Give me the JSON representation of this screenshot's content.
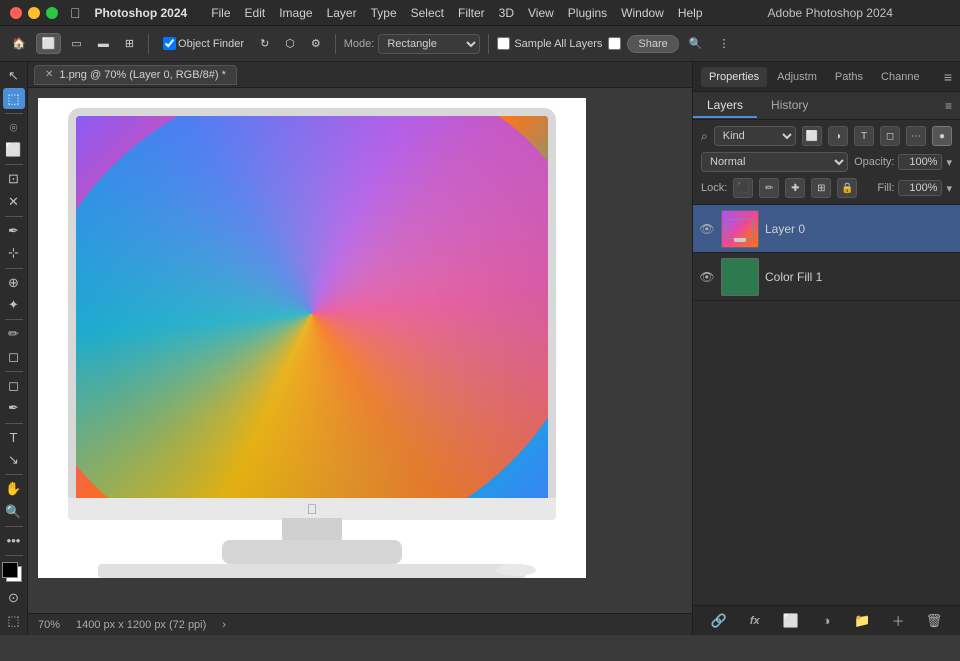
{
  "titlebar": {
    "app_name": "Photoshop 2024",
    "menu_items": [
      "File",
      "Edit",
      "Image",
      "Layer",
      "Type",
      "Select",
      "Filter",
      "3D",
      "View",
      "Plugins",
      "Window",
      "Help"
    ],
    "center_title": "Adobe Photoshop 2024"
  },
  "toolbar": {
    "object_finder": "Object Finder",
    "mode_label": "Mode:",
    "mode_value": "Rectangle",
    "sample_all_layers": "Sample All Layers",
    "share_label": "Share"
  },
  "tab": {
    "filename": "1.png @ 70% (Layer 0, RGB/8#) *"
  },
  "panels": {
    "properties_label": "Properties",
    "adjustments_label": "Adjustm",
    "paths_label": "Paths",
    "channels_label": "Channe",
    "layers_label": "Layers",
    "history_label": "History"
  },
  "layers": {
    "kind_label": "Kind",
    "blend_mode": "Normal",
    "opacity_label": "Opacity:",
    "opacity_value": "100%",
    "lock_label": "Lock:",
    "fill_label": "Fill:",
    "fill_value": "100%",
    "items": [
      {
        "name": "Layer 0",
        "visible": true,
        "active": true,
        "type": "image"
      },
      {
        "name": "Color Fill 1",
        "visible": true,
        "active": false,
        "type": "fill"
      }
    ]
  },
  "status_bar": {
    "zoom": "70%",
    "dimensions": "1400 px x 1200 px (72 ppi)"
  },
  "icons": {
    "close": "✕",
    "apple": "",
    "eye": "👁",
    "menu": "≡",
    "chevron": "▾",
    "search": "⌕",
    "link": "🔗",
    "fx": "fx",
    "mask": "⬜",
    "folder": "📁",
    "trash": "🗑",
    "new_layer": "＋",
    "adjust": "◑",
    "lock_pixel": "⬜",
    "lock_pos": "✚",
    "lock_art": "⬡",
    "lock_all": "🔒"
  }
}
